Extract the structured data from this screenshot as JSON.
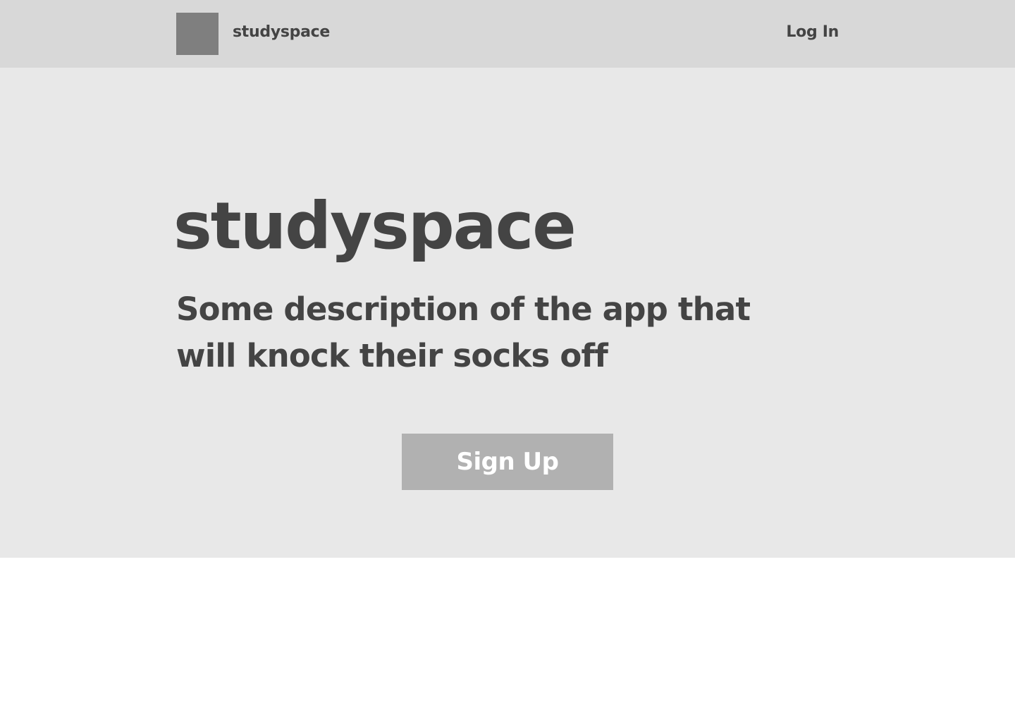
{
  "header": {
    "brand": "studyspace",
    "login_label": "Log In"
  },
  "hero": {
    "title": "studyspace",
    "description": "Some description of the app that will knock their socks off",
    "signup_label": "Sign Up"
  },
  "icons": {
    "logo": "logo-placeholder-icon"
  },
  "colors": {
    "header_bg": "#d8d8d8",
    "hero_bg": "#e8e8e8",
    "logo_placeholder": "#7f7f7f",
    "text": "#444444",
    "button_bg": "#b1b1b1",
    "button_text": "#ffffff",
    "page_bg": "#ffffff"
  }
}
